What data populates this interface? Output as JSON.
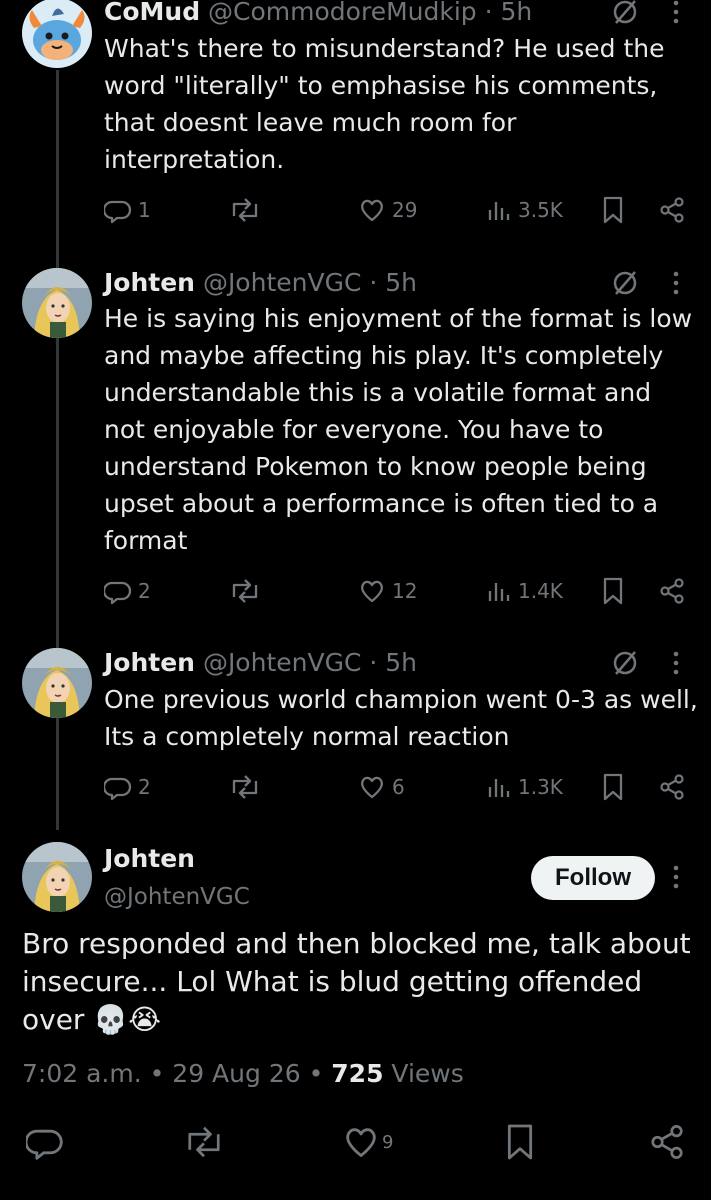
{
  "tweets": [
    {
      "name": "CoMud",
      "handle": "@CommodoreMudkip",
      "time": "5h",
      "avatar_icon": "mudkip-avatar",
      "text": "What's there to misunderstand? He used the word \"literally\" to emphasise his comments, that doesnt leave much room for interpretation.",
      "replies": "1",
      "reposts": "",
      "likes": "29",
      "views": "3.5K"
    },
    {
      "name": "Johten",
      "handle": "@JohtenVGC",
      "time": "5h",
      "avatar_icon": "anime-character-avatar",
      "text": "He is saying his enjoyment of the format is low and maybe affecting his play. It's completely understandable this is a volatile format and not enjoyable for everyone. You have to understand Pokemon to know people being upset about a performance is often tied to a format",
      "replies": "2",
      "reposts": "",
      "likes": "12",
      "views": "1.4K"
    },
    {
      "name": "Johten",
      "handle": "@JohtenVGC",
      "time": "5h",
      "avatar_icon": "anime-character-avatar",
      "text": "One previous world champion went 0-3 as well, Its a completely normal reaction",
      "replies": "2",
      "reposts": "",
      "likes": "6",
      "views": "1.3K"
    }
  ],
  "main_tweet": {
    "name": "Johten",
    "handle": "@JohtenVGC",
    "follow_label": "Follow",
    "text": "Bro responded and then blocked me, talk about insecure... Lol What is blud getting offended over 💀😭",
    "time": "7:02 a.m.",
    "date": "29 Aug 26",
    "views_count": "725",
    "views_label": "Views",
    "likes": "9"
  },
  "colors": {
    "background": "#000000",
    "text": "#e7e9ea",
    "muted": "#71767b",
    "thread_line": "#333639",
    "follow_bg": "#eff3f4"
  }
}
